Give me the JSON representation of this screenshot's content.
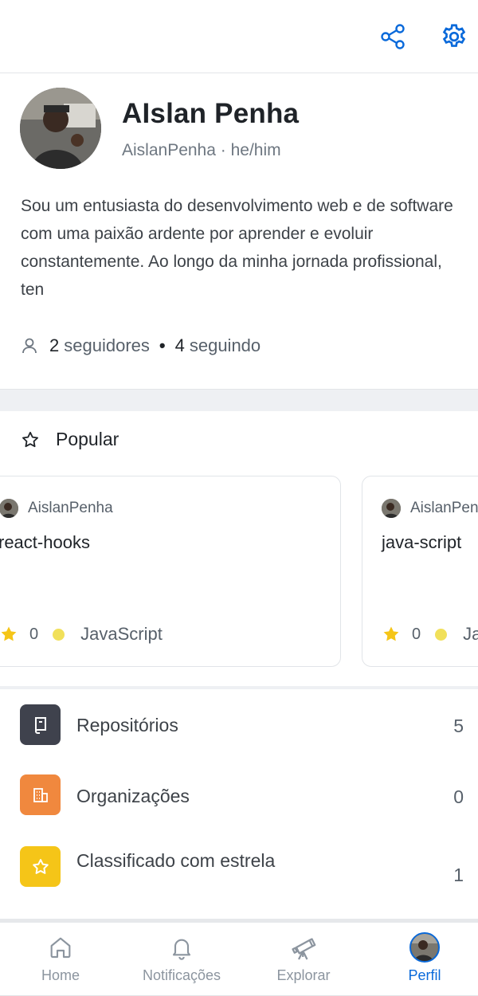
{
  "header": {
    "share_icon": "share-icon",
    "settings_icon": "gear-icon"
  },
  "profile": {
    "name": "AIslan Penha",
    "handle_line": "AislanPenha · he/him",
    "bio": "Sou um entusiasta do desenvolvimento web e de software com uma paixão ardente por aprender e evoluir constantemente. Ao longo da minha jornada profissional, ten",
    "followers_count": "2",
    "followers_label": "seguidores",
    "following_count": "4",
    "following_label": "seguindo",
    "separator": "•"
  },
  "popular": {
    "title": "Popular",
    "cards": [
      {
        "owner": "AislanPenha",
        "repo": "react-hooks",
        "stars": "0",
        "language": "JavaScript"
      },
      {
        "owner": "AislanPenha",
        "repo": "java-script",
        "stars": "0",
        "language": "JavaScript"
      }
    ]
  },
  "lists": [
    {
      "label": "Repositórios",
      "value": "5",
      "icon": "repo-icon",
      "color": "#3f424d"
    },
    {
      "label": "Organizações",
      "value": "0",
      "icon": "organization-icon",
      "color": "#f0883e"
    },
    {
      "label": "Classificado com estrela",
      "value": "1",
      "icon": "star-icon",
      "color": "#f5c518"
    }
  ],
  "tabs": [
    {
      "label": "Home",
      "icon": "home-icon"
    },
    {
      "label": "Notificações",
      "icon": "bell-icon"
    },
    {
      "label": "Explorar",
      "icon": "telescope-icon"
    },
    {
      "label": "Perfil",
      "icon": "avatar",
      "active": true
    }
  ],
  "colors": {
    "accent": "#0969da",
    "star": "#f5c518",
    "language_dot": "#f1e05a"
  }
}
